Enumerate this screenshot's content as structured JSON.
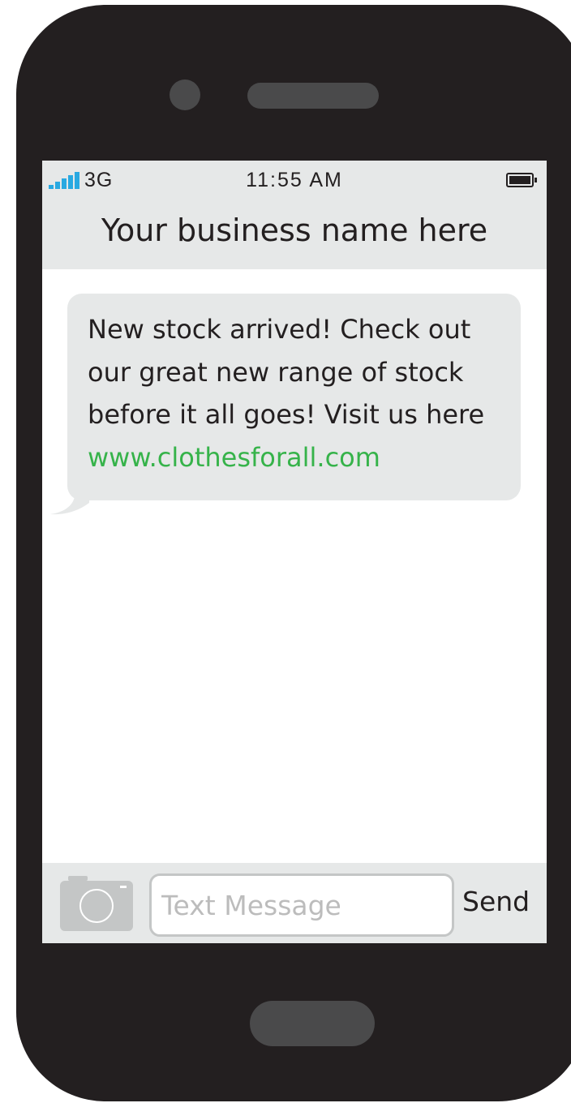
{
  "colors": {
    "phone_body": "#231f20",
    "phone_details": "#4a4a4b",
    "bar_background": "#e6e8e8",
    "bubble": "#e6e8e8",
    "link": "#36b34a",
    "signal": "#29a9e1",
    "camera_icon": "#c4c6c6"
  },
  "status_bar": {
    "signal_icon": "signal-bars-icon",
    "network": "3G",
    "time": "11:55 AM",
    "battery_icon": "battery-icon"
  },
  "header": {
    "title": "Your business name here"
  },
  "messages": [
    {
      "lines": [
        "New stock arrived! Check out",
        "our great new range of stock",
        "before it all goes! Visit us here"
      ],
      "link": "www.clothesforall.com"
    }
  ],
  "composer": {
    "camera_icon": "camera-icon",
    "placeholder": "Text Message",
    "send_label": "Send"
  }
}
